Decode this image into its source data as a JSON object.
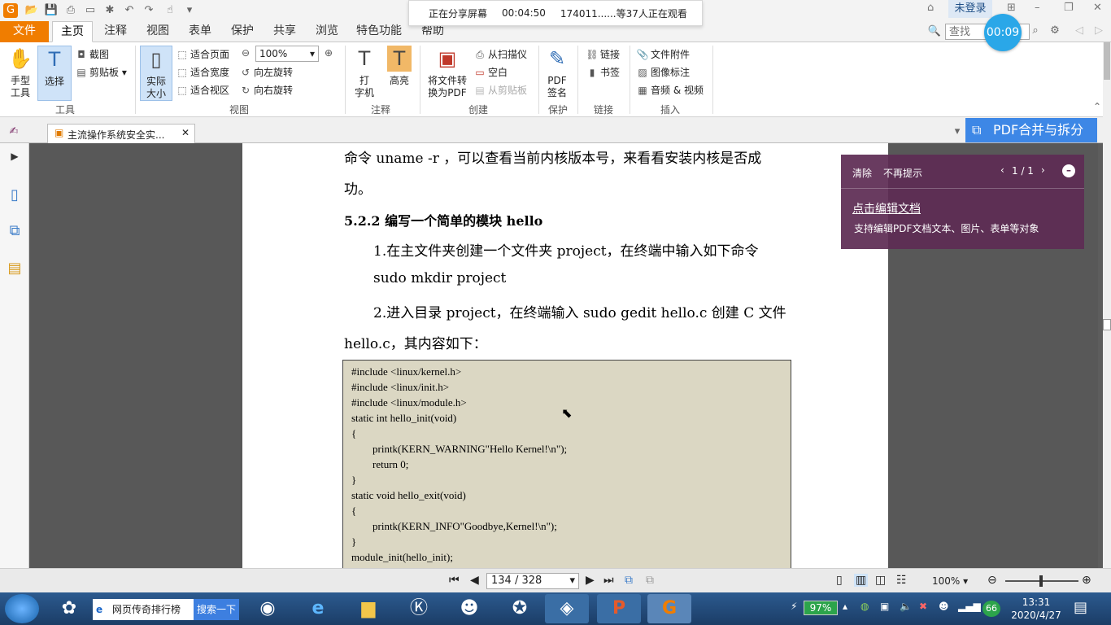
{
  "share_banner": {
    "status": "正在分享屏幕",
    "elapsed": "00:04:50",
    "viewers": "174011......等37人正在观看"
  },
  "window": {
    "login_label": "未登录"
  },
  "menu": {
    "file": "文件",
    "tabs": [
      "主页",
      "注释",
      "视图",
      "表单",
      "保护",
      "共享",
      "浏览",
      "特色功能",
      "帮助"
    ]
  },
  "search": {
    "placeholder": "查找"
  },
  "timer": "00:09",
  "ribbon": {
    "hand": "手型\n工具",
    "select": "选择",
    "screenshot": "截图",
    "clipboard": "剪贴板",
    "group_tools": "工具",
    "actual_size": "实际\n大小",
    "fit_page": "适合页面",
    "fit_width": "适合宽度",
    "fit_view": "适合视区",
    "zoom": "100%",
    "rotate_left": "向左旋转",
    "rotate_right": "向右旋转",
    "group_view": "视图",
    "typewriter": "打\n字机",
    "highlight": "高亮",
    "group_annot": "注释",
    "convert_pdf": "将文件转\n换为PDF",
    "from_scanner": "从扫描仪",
    "blank": "空白",
    "from_clipboard": "从剪贴板",
    "group_create": "创建",
    "pdf_sign": "PDF\n签名",
    "group_protect": "保护",
    "link": "链接",
    "bookmark": "书签",
    "group_link": "链接",
    "file_attach": "文件附件",
    "image_annot": "图像标注",
    "audio_video": "音频 & 视频",
    "group_insert": "插入"
  },
  "doc_tab": {
    "title": "主流操作系统安全实..."
  },
  "merge_button": "PDF合并与拆分",
  "tip": {
    "clear": "清除",
    "no_remind": "不再提示",
    "pager": "1 / 1",
    "link": "点击编辑文档",
    "desc": "支持编辑PDF文档文本、图片、表单等对象"
  },
  "page_content": {
    "line1": "命令 uname -r ，可以查看当前内核版本号，来看看安装内核是否成",
    "line2": "功。",
    "heading": "5.2.2  编写一个简单的模块 hello",
    "step1": "1.在主文件夹创建一个文件夹 project，在终端中输入如下命令",
    "cmd1": "sudo mkdir project",
    "step2": "2.进入目录 project，在终端输入 sudo gedit hello.c 创建 C 文件",
    "step2b": "hello.c，其内容如下：",
    "code": [
      "#include <linux/kernel.h>",
      "#include <linux/init.h>",
      "#include <linux/module.h>",
      "static int hello_init(void)",
      "{",
      "        printk(KERN_WARNING\"Hello Kernel!\\n\");",
      "        return 0;",
      "}",
      "static void hello_exit(void)",
      "{",
      "        printk(KERN_INFO\"Goodbye,Kernel!\\n\");",
      "}",
      "module_init(hello_init);"
    ]
  },
  "status": {
    "page": "134 / 328",
    "zoom": "100%"
  },
  "taskbar": {
    "search_text": "网页传奇排行榜",
    "search_button": "搜索一下",
    "battery": "97%",
    "time": "13:31",
    "date": "2020/4/27",
    "tray_badge": "66"
  },
  "colors": {
    "accent": "#f07d00",
    "merge": "#3d87e6",
    "tip_bg": "#5e2c54",
    "code_bg": "#dbd7c3"
  }
}
